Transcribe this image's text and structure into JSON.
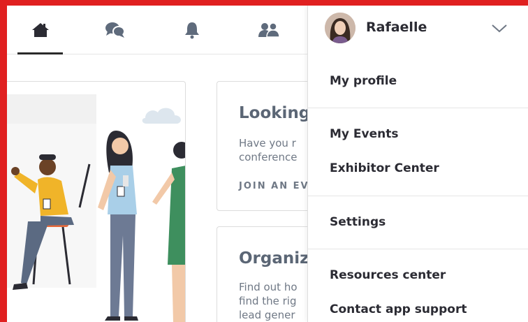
{
  "nav": {
    "icons": [
      "home-icon",
      "chat-bubbles-icon",
      "bell-icon",
      "people-icon"
    ],
    "active": "home-icon"
  },
  "cards": [
    {
      "title": "Looking",
      "body": [
        "Have you r",
        "conference"
      ],
      "link": "JOIN AN EV"
    },
    {
      "title": "Organiz",
      "body": [
        "Find out ho",
        "find the rig",
        "lead gener"
      ]
    }
  ],
  "user": {
    "name": "Rafaelle"
  },
  "menu": {
    "items": [
      "My profile",
      "My Events",
      "Exhibitor Center",
      "Settings",
      "Resources center",
      "Contact app support"
    ]
  },
  "colors": {
    "frame": "#e02020",
    "text_dark": "#2b2b33",
    "text_muted": "#6f7885"
  }
}
